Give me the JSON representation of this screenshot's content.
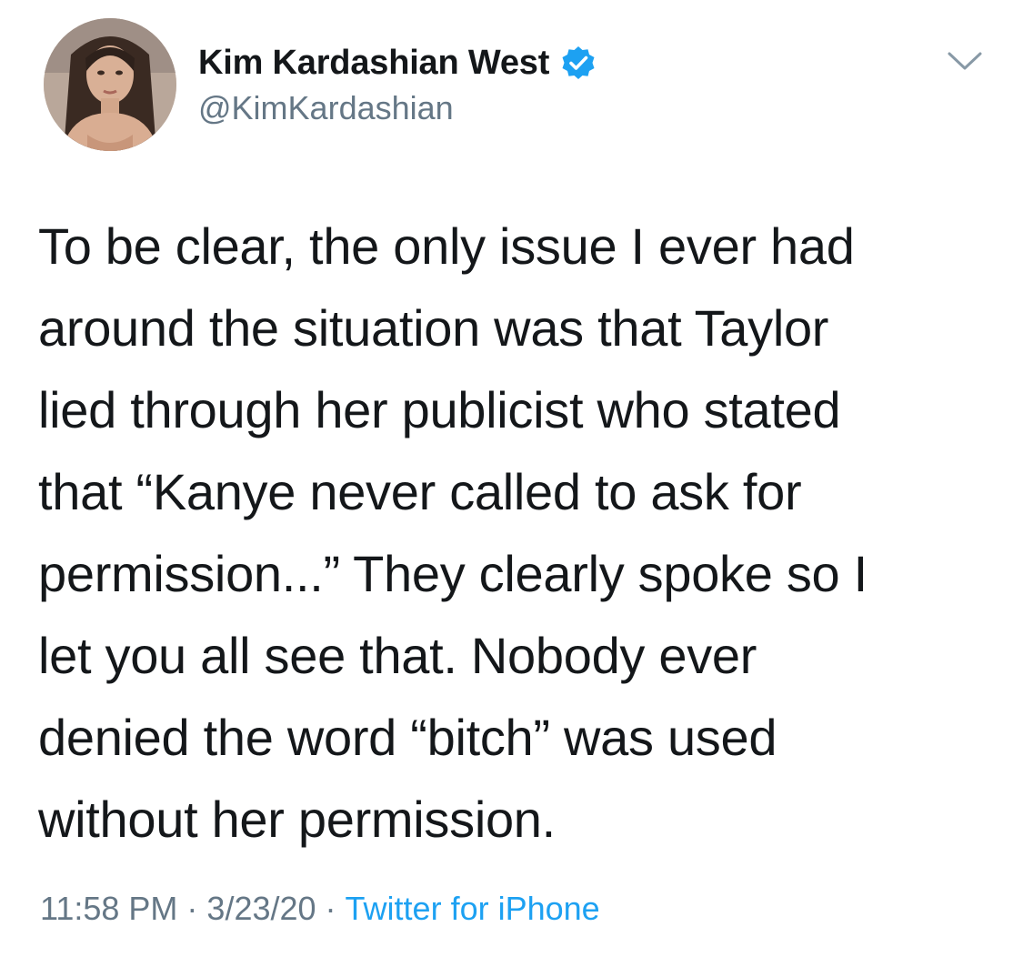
{
  "author": {
    "display_name": "Kim Kardashian West",
    "handle": "@KimKardashian",
    "verified_icon": "verified-badge-icon"
  },
  "tweet": {
    "text": "To be clear, the only issue I ever had\naround the situation was that Taylor\nlied through her publicist who stated\nthat “Kanye never called to ask for\npermission...” They clearly spoke so I\nlet you all see that. Nobody ever\ndenied the word “bitch” was used\nwithout her permission."
  },
  "meta": {
    "time": "11:58 PM",
    "separator": "·",
    "date": "3/23/20",
    "source": "Twitter for iPhone"
  },
  "icons": {
    "more": "chevron-down-icon"
  },
  "colors": {
    "text": "#14171a",
    "secondary": "#657786",
    "accent": "#1da1f2"
  }
}
